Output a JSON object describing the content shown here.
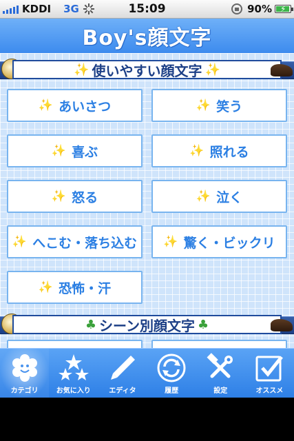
{
  "status_bar": {
    "carrier": "KDDI",
    "network": "3G",
    "time": "15:09",
    "battery_percent": "90%",
    "battery_level": 0.9
  },
  "header": {
    "title": "Boy's顔文字"
  },
  "sections": [
    {
      "title": "使いやすい顔文字",
      "title_icon": "sparkle",
      "buttons": [
        {
          "label": "あいさつ"
        },
        {
          "label": "笑う"
        },
        {
          "label": "喜ぶ"
        },
        {
          "label": "照れる"
        },
        {
          "label": "怒る"
        },
        {
          "label": "泣く"
        },
        {
          "label": "へこむ・落ち込む"
        },
        {
          "label": "驚く・ビックリ"
        },
        {
          "label": "恐怖・汗"
        }
      ]
    },
    {
      "title": "シーン別顔文字",
      "title_icon": "clover"
    }
  ],
  "tabbar": {
    "active": 0,
    "tabs": [
      {
        "label": "カテゴリ",
        "icon": "smiley-flower-icon"
      },
      {
        "label": "お気に入り",
        "icon": "stars-icon"
      },
      {
        "label": "エディタ",
        "icon": "pencil-icon"
      },
      {
        "label": "履歴",
        "icon": "history-icon"
      },
      {
        "label": "設定",
        "icon": "tools-icon"
      },
      {
        "label": "オススメ",
        "icon": "checkbox-icon"
      }
    ]
  },
  "colors": {
    "accent": "#2b7fe3",
    "tabbar": "#3d8bee",
    "section_band": "#1c3f86",
    "sparkle": "#f1c232",
    "clover": "#3aa13a"
  }
}
